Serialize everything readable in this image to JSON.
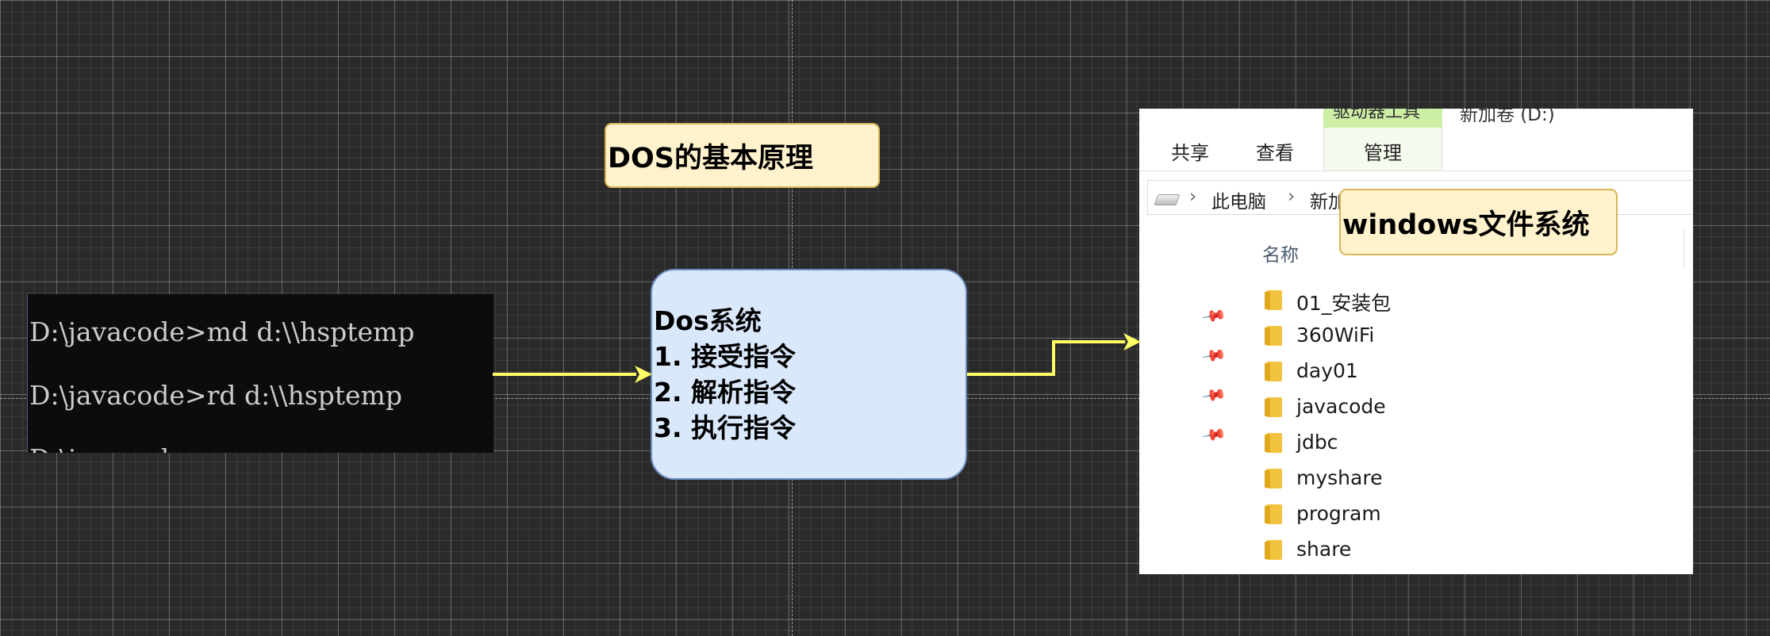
{
  "title": "DOS的基本原理",
  "cmd": {
    "lines": [
      "D:\\javacode>md d:\\\\hsptemp",
      "D:\\javacode>rd d:\\\\hsptemp",
      "D:\\javacode>"
    ]
  },
  "dos_box": {
    "heading": "Dos系统",
    "steps": [
      "1. 接受指令",
      "2. 解析指令",
      "3. 执行指令"
    ]
  },
  "explorer": {
    "ribbon": {
      "tab_share": "共享",
      "tab_view": "查看",
      "tab_tools": "驱动器工具",
      "tab_manage": "管理",
      "window_title": "新加卷 (D:)"
    },
    "address": {
      "this_pc": "此电脑",
      "drive": "新加卷 (D:)"
    },
    "column_header": "名称",
    "folders": [
      "01_安装包",
      "360WiFi",
      "day01",
      "javacode",
      "jdbc",
      "myshare",
      "program",
      "share"
    ]
  },
  "windows_label": "windows文件系统",
  "colors": {
    "arrow": "#ffff66",
    "note_fill": "#fff2cc",
    "note_border": "#d6b656",
    "process_fill": "#dae8fc",
    "process_border": "#6c8ebf"
  },
  "icons": [
    "drive-icon",
    "chevron-right-icon",
    "pin-icon",
    "folder-icon"
  ]
}
